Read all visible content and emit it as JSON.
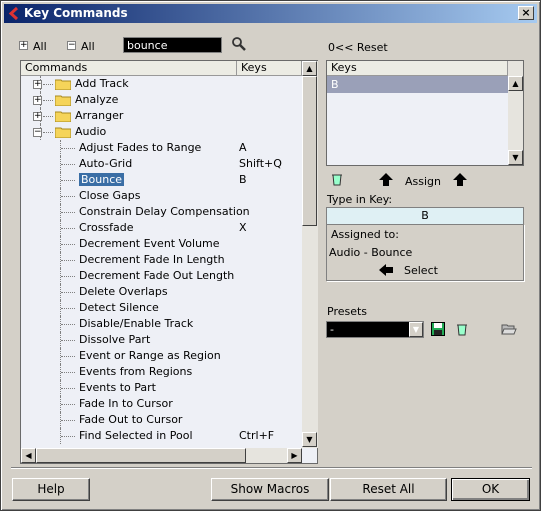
{
  "window": {
    "title": "Key Commands",
    "close_label": "×"
  },
  "toolbar": {
    "expand_all": "All",
    "collapse_all": "All",
    "search_value": "bounce",
    "reset_label": "0<< Reset"
  },
  "tree": {
    "col_commands": "Commands",
    "col_keys": "Keys",
    "folders": [
      {
        "label": "Add Track",
        "expanded": false
      },
      {
        "label": "Analyze",
        "expanded": false
      },
      {
        "label": "Arranger",
        "expanded": false
      },
      {
        "label": "Audio",
        "expanded": true
      }
    ],
    "items": [
      {
        "label": "Adjust Fades to Range",
        "key": "A"
      },
      {
        "label": "Auto-Grid",
        "key": "Shift+Q"
      },
      {
        "label": "Bounce",
        "key": "B",
        "selected": true
      },
      {
        "label": "Close Gaps",
        "key": ""
      },
      {
        "label": "Constrain Delay Compensation",
        "key": ""
      },
      {
        "label": "Crossfade",
        "key": "X"
      },
      {
        "label": "Decrement Event Volume",
        "key": ""
      },
      {
        "label": "Decrement Fade In Length",
        "key": ""
      },
      {
        "label": "Decrement Fade Out Length",
        "key": ""
      },
      {
        "label": "Delete Overlaps",
        "key": ""
      },
      {
        "label": "Detect Silence",
        "key": ""
      },
      {
        "label": "Disable/Enable Track",
        "key": ""
      },
      {
        "label": "Dissolve Part",
        "key": ""
      },
      {
        "label": "Event or Range as Region",
        "key": ""
      },
      {
        "label": "Events from Regions",
        "key": ""
      },
      {
        "label": "Events to Part",
        "key": ""
      },
      {
        "label": "Fade In to Cursor",
        "key": ""
      },
      {
        "label": "Fade Out to Cursor",
        "key": ""
      },
      {
        "label": "Find Selected in Pool",
        "key": "Ctrl+F"
      }
    ]
  },
  "keys_panel": {
    "header": "Keys",
    "items": [
      "B"
    ]
  },
  "assign": {
    "label": "Assign"
  },
  "type_in_key": {
    "label": "Type in Key:",
    "value": "B"
  },
  "assigned_to": {
    "label": "Assigned to:",
    "value": "Audio - Bounce",
    "select_label": "Select"
  },
  "presets": {
    "label": "Presets",
    "value": "-"
  },
  "footer": {
    "help": "Help",
    "show_macros": "Show Macros",
    "reset_all": "Reset All",
    "ok": "OK"
  },
  "colors": {
    "title_start": "#0a246a",
    "title_end": "#a6caf0",
    "selection": "#3a6ea5",
    "key_field": "#dff0f4"
  }
}
